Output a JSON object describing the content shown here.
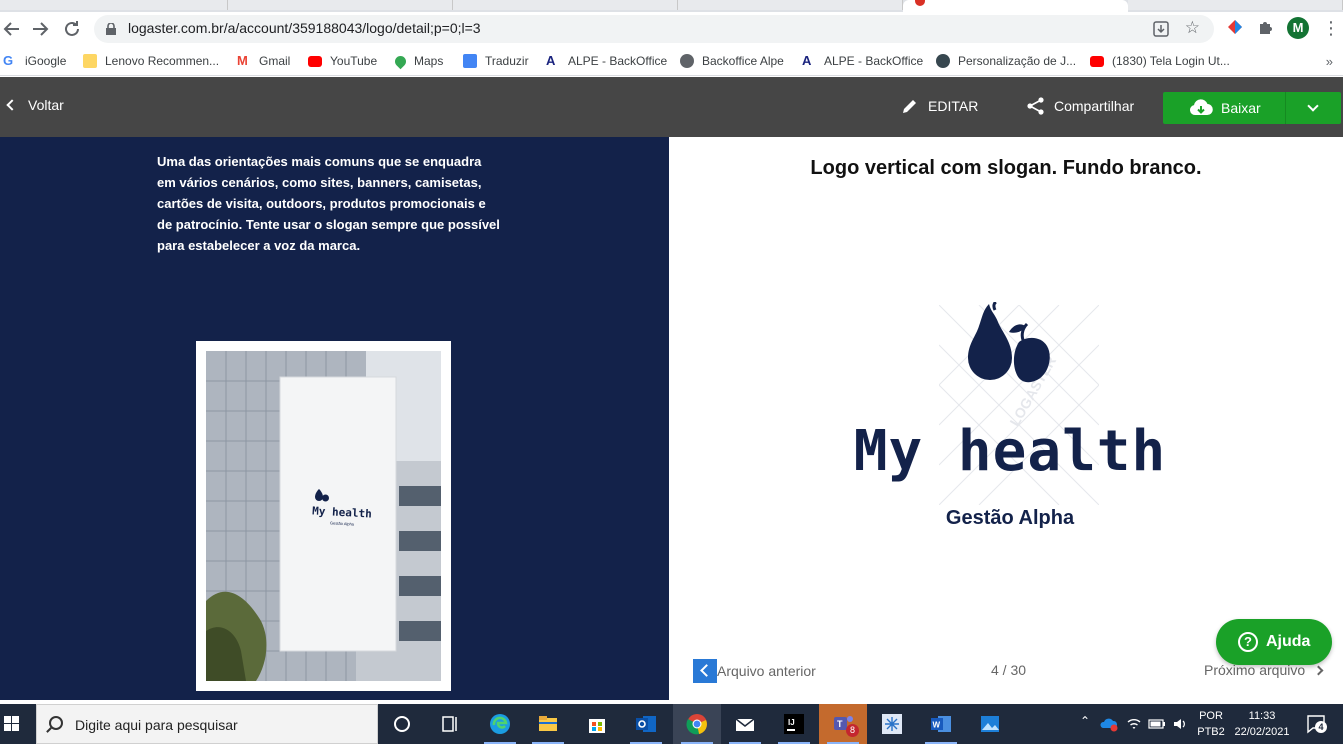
{
  "browser": {
    "url": "logaster.com.br/a/account/359188043/logo/detail;p=0;l=3",
    "bookmarks": [
      {
        "label": "iGoogle",
        "icon": "google-icon"
      },
      {
        "label": "Lenovo Recommen...",
        "icon": "folder-icon"
      },
      {
        "label": "Gmail",
        "icon": "gmail-icon"
      },
      {
        "label": "YouTube",
        "icon": "youtube-icon"
      },
      {
        "label": "Maps",
        "icon": "maps-icon"
      },
      {
        "label": "Traduzir",
        "icon": "translate-icon"
      },
      {
        "label": "ALPE - BackOffice",
        "icon": "alpe-icon"
      },
      {
        "label": "Backoffice Alpe",
        "icon": "globe-icon"
      },
      {
        "label": "ALPE - BackOffice",
        "icon": "alpe-icon"
      },
      {
        "label": "Personalização de J...",
        "icon": "site-icon"
      },
      {
        "label": "(1830) Tela Login Ut...",
        "icon": "youtube-icon"
      }
    ],
    "profile_initial": "M"
  },
  "header": {
    "back_label": "Voltar",
    "edit_label": "EDITAR",
    "share_label": "Compartilhar",
    "download_label": "Baixar"
  },
  "left": {
    "description": "Uma das orientações mais comuns que se enquadra em vários cenários, como sites, banners, camisetas, cartões de visita, outdoors, produtos promocionais e de patrocínio. Tente usar o slogan sempre que possível para estabelecer a voz da marca.",
    "mockup_wordmark": "My health",
    "mockup_slogan": "Gestão Alpha"
  },
  "right": {
    "title": "Logo vertical com slogan. Fundo branco.",
    "wordmark": "My health",
    "slogan": "Gestão Alpha",
    "watermark": "LOGASTER",
    "prev_label": "Arquivo anterior",
    "counter": "4 / 30",
    "next_label": "Próximo arquivo",
    "help_label": "Ajuda"
  },
  "colors": {
    "brand_navy": "#13224a",
    "header_gray": "#464646",
    "button_green": "#1aa128",
    "nav_blue": "#2979d6"
  },
  "taskbar": {
    "search_placeholder": "Digite aqui para pesquisar",
    "lang_top": "POR",
    "lang_bottom": "PTB2",
    "time": "11:33",
    "date": "22/02/2021",
    "notifications": "4",
    "teams_badge": "8"
  }
}
